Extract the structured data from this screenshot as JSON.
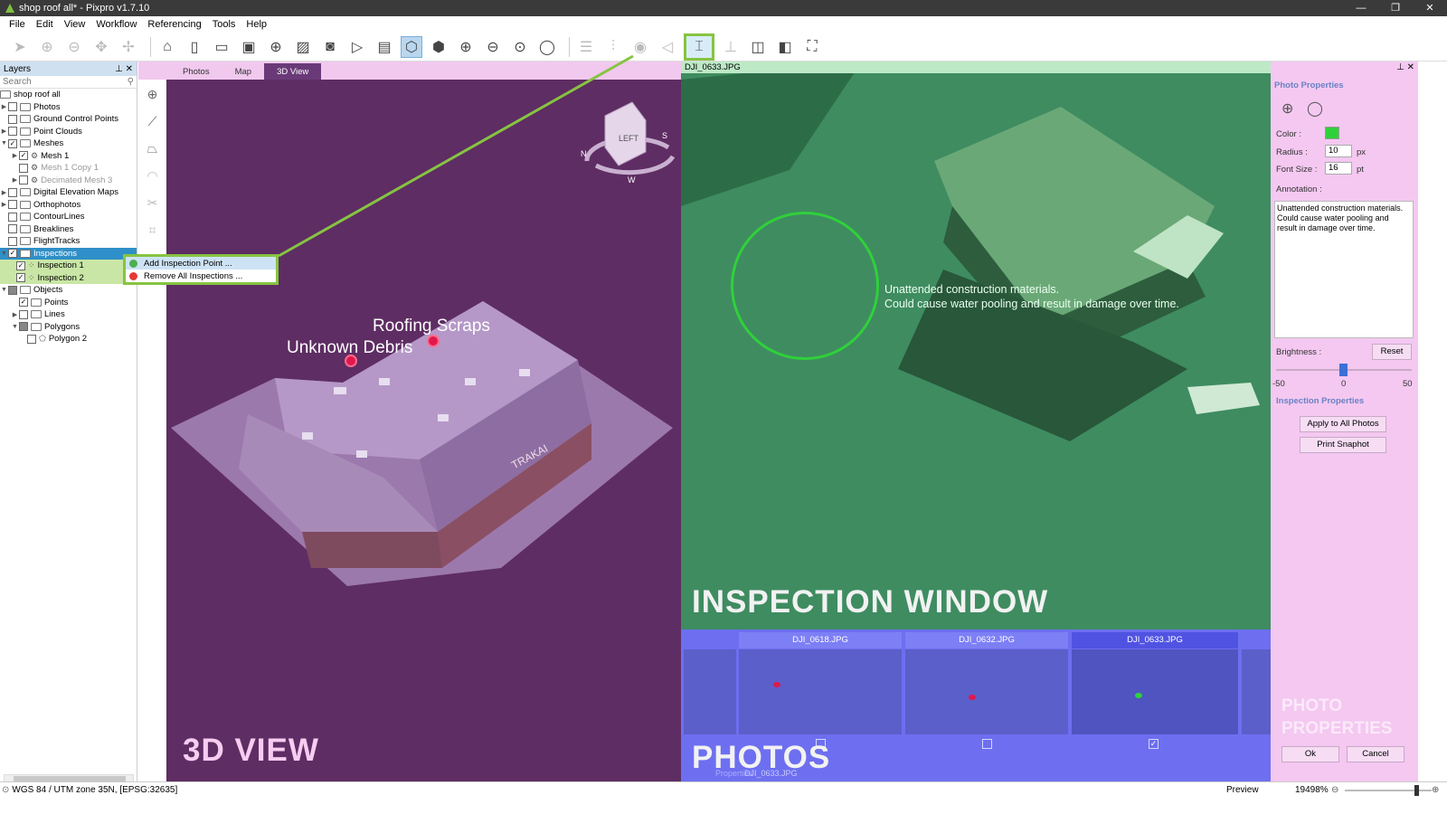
{
  "window": {
    "title": "shop roof all* - Pixpro v1.7.10",
    "min": "—",
    "max": "❐",
    "close": "✕"
  },
  "menu": [
    "File",
    "Edit",
    "View",
    "Workflow",
    "Referencing",
    "Tools",
    "Help"
  ],
  "layers": {
    "header": "Layers",
    "search_placeholder": "Search",
    "root": "shop roof all",
    "items": [
      {
        "label": "Photos"
      },
      {
        "label": "Ground Control Points"
      },
      {
        "label": "Point Clouds"
      },
      {
        "label": "Meshes"
      },
      {
        "label": "Mesh 1"
      },
      {
        "label": "Mesh 1 Copy 1"
      },
      {
        "label": "Decimated Mesh 3"
      },
      {
        "label": "Digital Elevation Maps"
      },
      {
        "label": "Orthophotos"
      },
      {
        "label": "ContourLines"
      },
      {
        "label": "Breaklines"
      },
      {
        "label": "FlightTracks"
      },
      {
        "label": "Inspections"
      },
      {
        "label": "Inspection 1"
      },
      {
        "label": "Inspection 2"
      },
      {
        "label": "Objects"
      },
      {
        "label": "Points"
      },
      {
        "label": "Lines"
      },
      {
        "label": "Polygons"
      },
      {
        "label": "Polygon 2"
      }
    ]
  },
  "context_menu": {
    "add": "Add Inspection Point ...",
    "remove": "Remove All Inspections ..."
  },
  "view_tabs": [
    "Photos",
    "Map",
    "3D View"
  ],
  "view3d": {
    "label": "3D VIEW",
    "cube_face": "LEFT",
    "compass": {
      "s": "S",
      "n": "N",
      "w": "W"
    },
    "annotations": [
      "Roofing Scraps",
      "Unknown Debris"
    ],
    "sign": "TRAKAI"
  },
  "inspection": {
    "file": "DJI_0633.JPG",
    "label": "INSPECTION WINDOW",
    "text_line1": "Unattended construction materials.",
    "text_line2": "Could cause water pooling and result in damage over time."
  },
  "photos": {
    "label": "PHOTOS",
    "thumbs": [
      {
        "name": "DJI_0618.JPG",
        "checked": false
      },
      {
        "name": "DJI_0632.JPG",
        "checked": false
      },
      {
        "name": "DJI_0633.JPG",
        "checked": true
      }
    ],
    "props_tab": "Properties",
    "file_tab": "DJI_0633.JPG"
  },
  "properties": {
    "section": "Photo Properties",
    "color_label": "Color :",
    "color": "#2fd13a",
    "radius_label": "Radius :",
    "radius": "10",
    "radius_unit": "px",
    "font_label": "Font Size :",
    "font_size": "16",
    "font_unit": "pt",
    "annotation_label": "Annotation :",
    "annotation": "Unattended construction materials. Could cause water pooling and result in damage over time.",
    "brightness_label": "Brightness :",
    "reset": "Reset",
    "min": "-50",
    "zero": "0",
    "max": "50",
    "brightness_value": 0,
    "inspection_section": "Inspection Properties",
    "apply": "Apply to All Photos",
    "print": "Print Snaphot",
    "overlay_line1": "PHOTO",
    "overlay_line2": "PROPERTIES",
    "ok": "Ok",
    "cancel": "Cancel"
  },
  "status": {
    "crs": "WGS 84 / UTM zone 35N, [EPSG:32635]",
    "preview": "Preview",
    "zoom": "19498%"
  }
}
